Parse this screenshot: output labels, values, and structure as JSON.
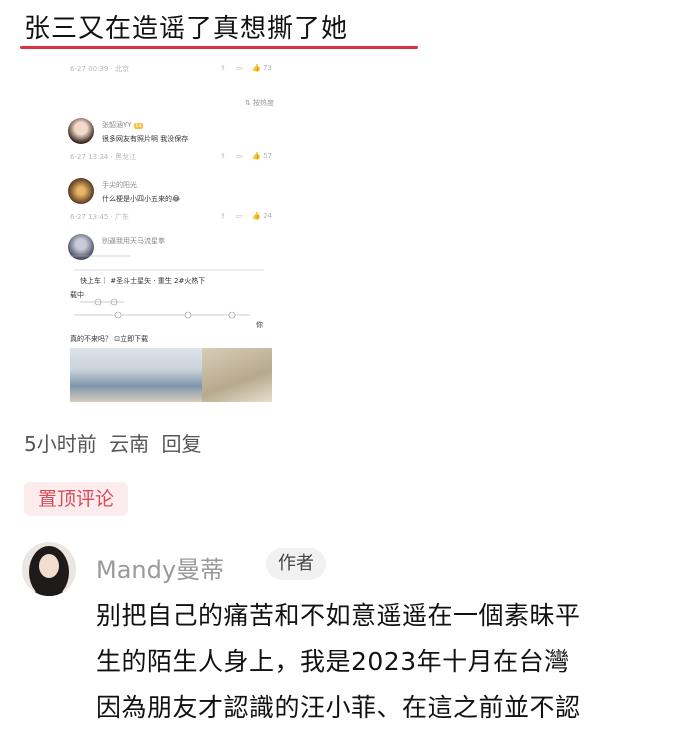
{
  "headline": "张三又在造谣了真想撕了她",
  "accent_color": "#d9333f",
  "embedded": {
    "top_meta": "6-27 00:39 · 北京",
    "top_like_count": "73",
    "sort_label": "按热度",
    "comments": [
      {
        "name": "张韶涵YY",
        "badge": "Lv",
        "text": "很多网友有照片啊 我没保存",
        "meta": "6-27 13:24 · 黑龙江",
        "like_count": "57"
      },
      {
        "name": "手尖的阳光",
        "text": "什么梗是小四小五来的😂",
        "meta": "6-27 13:45 · 广东",
        "like_count": "24"
      },
      {
        "name": "别逼我用天马流星拳",
        "embed_line1": "快上车｜ #圣斗士星矢 · 重生 2#火热下",
        "embed_line2": "载中",
        "embed_tail": "你",
        "embed_line3": "真的不来吗？",
        "embed_download": "立即下载"
      }
    ]
  },
  "comment_meta": {
    "time": "5小时前",
    "location": "云南",
    "reply": "回复"
  },
  "pinned_label": "置顶评论",
  "author": {
    "name": "Mandy曼蒂",
    "badge": "作者",
    "lines": [
      "别把自己的痛苦和不如意遥遥在一個素昧平",
      "生的陌生人身上，我是2023年十月在台灣",
      "因為朋友才認識的汪小菲、在這之前並不認"
    ]
  }
}
